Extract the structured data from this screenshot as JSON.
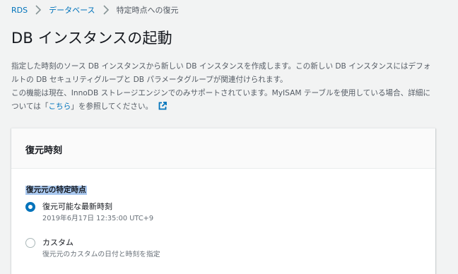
{
  "breadcrumb": {
    "items": [
      "RDS",
      "データベース"
    ],
    "current": "特定時点への復元"
  },
  "page": {
    "title": "DB インスタンスの起動"
  },
  "description": {
    "line1": "指定した時刻のソース DB インスタンスから新しい DB インスタンスを作成します。この新しい DB インスタンスにはデフォルトの DB セキュリティグループと DB パラメータグループが関連付けられます。",
    "line2_prefix": "この機能は現在、InnoDB ストレージエンジンでのみサポートされています。MyISAM テーブルを使用している場合、詳細については「",
    "line2_link": "こちら",
    "line2_suffix": "」を参照してください。",
    "external_icon": "external-link-icon"
  },
  "panel": {
    "title": "復元時刻",
    "field_label": "復元元の特定時点",
    "options": [
      {
        "label": "復元可能な最新時刻",
        "description": "2019年6月17日 12:35:00 UTC+9",
        "selected": true
      },
      {
        "label": "カスタム",
        "description": "復元元のカスタムの日付と時刻を指定",
        "selected": false
      }
    ]
  },
  "colors": {
    "link": "#0073bb",
    "background": "#f2f3f3",
    "radio_selected": "#0073bb",
    "selection_highlight": "#a9c8ef"
  }
}
